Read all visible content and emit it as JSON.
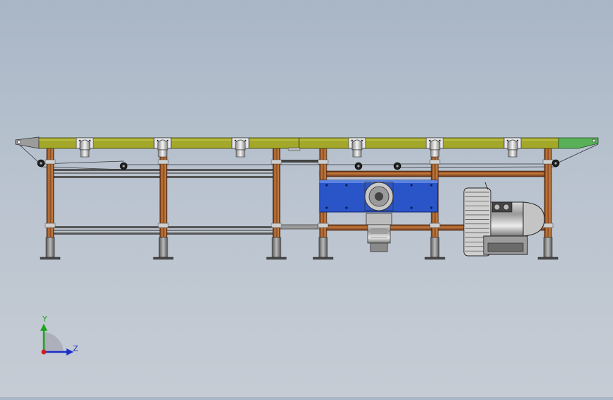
{
  "axis_triad": {
    "y_label": "Y",
    "z_label": "Z",
    "x_color": "#d21e1e",
    "y_color": "#1fa31f",
    "z_color": "#1b2fc9"
  },
  "colors": {
    "conveyor_top": "#a3a82a",
    "conveyor_end_right": "#58b058",
    "frame_post": "#8c4a22",
    "frame_post_light": "#c87a3c",
    "gearbox_plate": "#2a55c9",
    "metal_dark": "#2a2a2a",
    "metal_light": "#d6d6d6"
  },
  "icons": {
    "motor": "vacuum-blower-motor-icon",
    "drive": "gear-drive-icon"
  }
}
